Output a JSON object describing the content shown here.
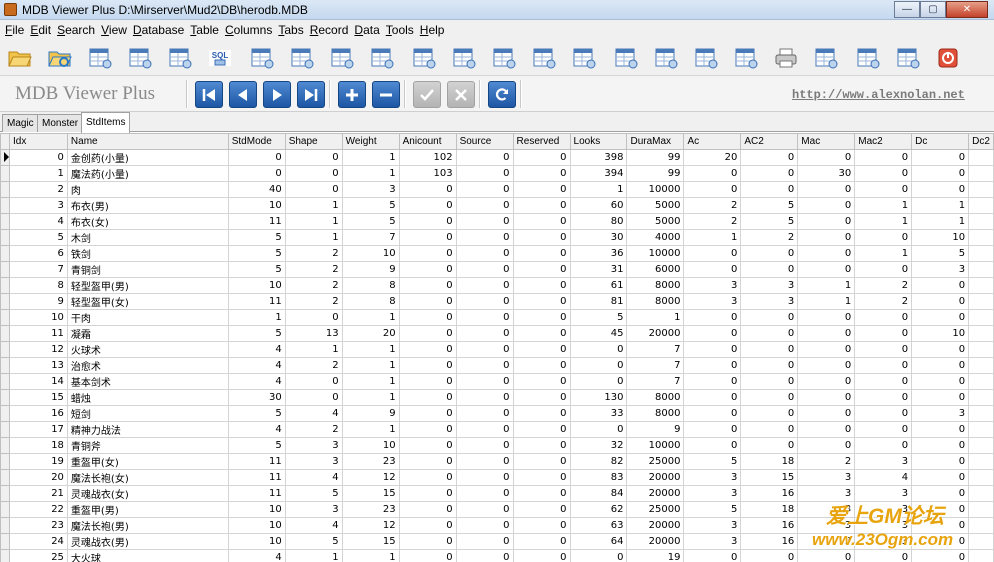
{
  "window": {
    "title": "MDB Viewer Plus D:\\Mirserver\\Mud2\\DB\\herodb.MDB",
    "minimize_label": "—",
    "maximize_label": "▢",
    "close_label": "✕"
  },
  "menu": [
    {
      "first": "F",
      "rest": "ile"
    },
    {
      "first": "E",
      "rest": "dit"
    },
    {
      "first": "S",
      "rest": "earch"
    },
    {
      "first": "V",
      "rest": "iew"
    },
    {
      "first": "D",
      "rest": "atabase"
    },
    {
      "first": "T",
      "rest": "able"
    },
    {
      "first": "C",
      "rest": "olumns"
    },
    {
      "first": "T",
      "rest": "abs"
    },
    {
      "first": "R",
      "rest": "ecord"
    },
    {
      "first": "D",
      "rest": "ata"
    },
    {
      "first": "T",
      "rest": "ools"
    },
    {
      "first": "H",
      "rest": "elp"
    }
  ],
  "toolbar": {
    "sql_label": "SQL",
    "icons": [
      "open-folder-icon",
      "refresh-folder-icon",
      "table-icon",
      "find-icon",
      "zoom-icon",
      "sql-icon",
      "export-icon",
      "tables-icon",
      "columns-icon",
      "table-info-icon",
      "add-table-icon",
      "delete-table-icon",
      "edit-icon",
      "sort-icon",
      "relation-icon",
      "settings-icon",
      "schema-icon",
      "import-icon",
      "export-data-icon",
      "print-icon",
      "copy-icon",
      "query-icon",
      "tools-icon",
      "power-icon"
    ]
  },
  "nav": {
    "brand": "MDB Viewer Plus",
    "url": "http://www.alexnolan.net",
    "buttons": [
      {
        "name": "first-record-button",
        "glyph": "first",
        "enabled": true
      },
      {
        "name": "prev-record-button",
        "glyph": "prev",
        "enabled": true
      },
      {
        "name": "next-record-button",
        "glyph": "next",
        "enabled": true
      },
      {
        "name": "last-record-button",
        "glyph": "last",
        "enabled": true
      },
      {
        "name": "add-record-button",
        "glyph": "plus",
        "enabled": true
      },
      {
        "name": "delete-record-button",
        "glyph": "minus",
        "enabled": true
      },
      {
        "name": "post-record-button",
        "glyph": "check",
        "enabled": false
      },
      {
        "name": "cancel-record-button",
        "glyph": "cross",
        "enabled": false
      },
      {
        "name": "refresh-record-button",
        "glyph": "refresh",
        "enabled": true
      }
    ]
  },
  "tabs": [
    {
      "label": "Magic",
      "active": false
    },
    {
      "label": "Monster",
      "active": false
    },
    {
      "label": "StdItems",
      "active": true
    }
  ],
  "grid": {
    "columns": [
      "Idx",
      "Name",
      "StdMode",
      "Shape",
      "Weight",
      "Anicount",
      "Source",
      "Reserved",
      "Looks",
      "DuraMax",
      "Ac",
      "AC2",
      "Mac",
      "Mac2",
      "Dc",
      "Dc2"
    ],
    "rows": [
      [
        "0",
        "金创药(小量)",
        "0",
        "0",
        "1",
        "102",
        "0",
        "0",
        "398",
        "99",
        "20",
        "0",
        "0",
        "0",
        "0"
      ],
      [
        "1",
        "魔法药(小量)",
        "0",
        "0",
        "1",
        "103",
        "0",
        "0",
        "394",
        "99",
        "0",
        "0",
        "30",
        "0",
        "0"
      ],
      [
        "2",
        "肉",
        "40",
        "0",
        "3",
        "0",
        "0",
        "0",
        "1",
        "10000",
        "0",
        "0",
        "0",
        "0",
        "0"
      ],
      [
        "3",
        "布衣(男)",
        "10",
        "1",
        "5",
        "0",
        "0",
        "0",
        "60",
        "5000",
        "2",
        "5",
        "0",
        "1",
        "1"
      ],
      [
        "4",
        "布衣(女)",
        "11",
        "1",
        "5",
        "0",
        "0",
        "0",
        "80",
        "5000",
        "2",
        "5",
        "0",
        "1",
        "1"
      ],
      [
        "5",
        "木剑",
        "5",
        "1",
        "7",
        "0",
        "0",
        "0",
        "30",
        "4000",
        "1",
        "2",
        "0",
        "0",
        "10"
      ],
      [
        "6",
        "铁剑",
        "5",
        "2",
        "10",
        "0",
        "0",
        "0",
        "36",
        "10000",
        "0",
        "0",
        "0",
        "1",
        "5"
      ],
      [
        "7",
        "青铜剑",
        "5",
        "2",
        "9",
        "0",
        "0",
        "0",
        "31",
        "6000",
        "0",
        "0",
        "0",
        "0",
        "3"
      ],
      [
        "8",
        "轻型盔甲(男)",
        "10",
        "2",
        "8",
        "0",
        "0",
        "0",
        "61",
        "8000",
        "3",
        "3",
        "1",
        "2",
        "0"
      ],
      [
        "9",
        "轻型盔甲(女)",
        "11",
        "2",
        "8",
        "0",
        "0",
        "0",
        "81",
        "8000",
        "3",
        "3",
        "1",
        "2",
        "0"
      ],
      [
        "10",
        "干肉",
        "1",
        "0",
        "1",
        "0",
        "0",
        "0",
        "5",
        "1",
        "0",
        "0",
        "0",
        "0",
        "0"
      ],
      [
        "11",
        "凝霜",
        "5",
        "13",
        "20",
        "0",
        "0",
        "0",
        "45",
        "20000",
        "0",
        "0",
        "0",
        "0",
        "10"
      ],
      [
        "12",
        "火球术",
        "4",
        "1",
        "1",
        "0",
        "0",
        "0",
        "0",
        "7",
        "0",
        "0",
        "0",
        "0",
        "0"
      ],
      [
        "13",
        "治愈术",
        "4",
        "2",
        "1",
        "0",
        "0",
        "0",
        "0",
        "7",
        "0",
        "0",
        "0",
        "0",
        "0"
      ],
      [
        "14",
        "基本剑术",
        "4",
        "0",
        "1",
        "0",
        "0",
        "0",
        "0",
        "7",
        "0",
        "0",
        "0",
        "0",
        "0"
      ],
      [
        "15",
        "蜡烛",
        "30",
        "0",
        "1",
        "0",
        "0",
        "0",
        "130",
        "8000",
        "0",
        "0",
        "0",
        "0",
        "0"
      ],
      [
        "16",
        "短剑",
        "5",
        "4",
        "9",
        "0",
        "0",
        "0",
        "33",
        "8000",
        "0",
        "0",
        "0",
        "0",
        "3"
      ],
      [
        "17",
        "精神力战法",
        "4",
        "2",
        "1",
        "0",
        "0",
        "0",
        "0",
        "9",
        "0",
        "0",
        "0",
        "0",
        "0"
      ],
      [
        "18",
        "青铜斧",
        "5",
        "3",
        "10",
        "0",
        "0",
        "0",
        "32",
        "10000",
        "0",
        "0",
        "0",
        "0",
        "0"
      ],
      [
        "19",
        "重盔甲(女)",
        "11",
        "3",
        "23",
        "0",
        "0",
        "0",
        "82",
        "25000",
        "5",
        "18",
        "2",
        "3",
        "0"
      ],
      [
        "20",
        "魔法长袍(女)",
        "11",
        "4",
        "12",
        "0",
        "0",
        "0",
        "83",
        "20000",
        "3",
        "15",
        "3",
        "4",
        "0"
      ],
      [
        "21",
        "灵魂战衣(女)",
        "11",
        "5",
        "15",
        "0",
        "0",
        "0",
        "84",
        "20000",
        "3",
        "16",
        "3",
        "3",
        "0"
      ],
      [
        "22",
        "重盔甲(男)",
        "10",
        "3",
        "23",
        "0",
        "0",
        "0",
        "62",
        "25000",
        "5",
        "18",
        "3",
        "3",
        "0"
      ],
      [
        "23",
        "魔法长袍(男)",
        "10",
        "4",
        "12",
        "0",
        "0",
        "0",
        "63",
        "20000",
        "3",
        "16",
        "3",
        "3",
        "0"
      ],
      [
        "24",
        "灵魂战衣(男)",
        "10",
        "5",
        "15",
        "0",
        "0",
        "0",
        "64",
        "20000",
        "3",
        "16",
        "3",
        "3",
        "0"
      ],
      [
        "25",
        "大火球",
        "4",
        "1",
        "1",
        "0",
        "0",
        "0",
        "0",
        "19",
        "0",
        "0",
        "0",
        "0",
        "0"
      ]
    ]
  },
  "watermark": {
    "line1": "爱上GM论坛",
    "line2": "www.23Ogm.com"
  }
}
